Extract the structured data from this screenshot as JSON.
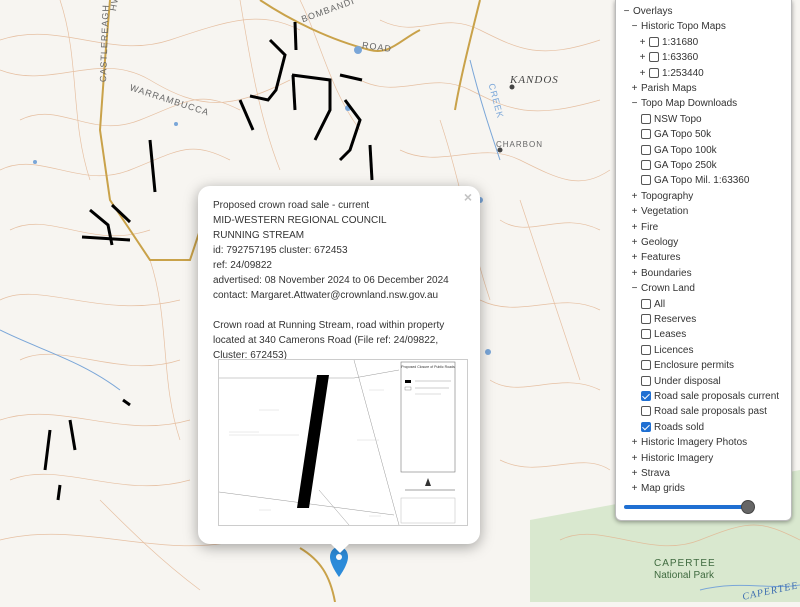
{
  "map": {
    "labels": {
      "castlereagh": "CASTLEREAGH",
      "hwy": "HWY",
      "bombandi": "BOMBANDI",
      "road": "ROAD",
      "warrumbucca": "WARRAMBUCCA",
      "kandos": "KANDOS",
      "charbon": "CHARBON",
      "capertee_np_1": "CAPERTEE",
      "capertee_np_2": "National Park",
      "capertee_bottom": "CAPERTEE",
      "creek": "CREEK"
    },
    "colors": {
      "background": "#f7f5f1",
      "contour": "#e2b38f",
      "road": "#c9a24a",
      "water": "#7aa6d8",
      "parcel": "#000000",
      "park": "#d9e8cf",
      "marker": "#2c8bd9"
    }
  },
  "popup": {
    "close_label": "×",
    "title": "Proposed crown road sale - current",
    "council": "MID-WESTERN REGIONAL COUNCIL",
    "locality": "RUNNING STREAM",
    "id_line": "id: 792757195 cluster: 672453",
    "ref_line": "ref: 24/09822",
    "advertised_line": "advertised: 08 November 2024 to 06 December 2024",
    "contact_line": "contact: Margaret.Attwater@crownland.nsw.gov.au",
    "description": "Crown road at Running Stream, road within property located at 340 Camerons Road (File ref: 24/09822, Cluster: 672453)",
    "thumbnail_legend_title": "Proposed Closure of Public Roads"
  },
  "layers": {
    "items": [
      {
        "label": "Overlays",
        "toggle": "−",
        "indent": 0
      },
      {
        "label": "Historic Topo Maps",
        "toggle": "−",
        "indent": 1
      },
      {
        "label": "1:31680",
        "toggle": "+",
        "checkbox": false,
        "indent": 2
      },
      {
        "label": "1:63360",
        "toggle": "+",
        "checkbox": false,
        "indent": 2
      },
      {
        "label": "1:253440",
        "toggle": "+",
        "checkbox": false,
        "indent": 2
      },
      {
        "label": "Parish Maps",
        "toggle": "+",
        "indent": 1
      },
      {
        "label": "Topo Map Downloads",
        "toggle": "−",
        "indent": 1
      },
      {
        "label": "NSW Topo",
        "checkbox": false,
        "indent": 2
      },
      {
        "label": "GA Topo 50k",
        "checkbox": false,
        "indent": 2
      },
      {
        "label": "GA Topo 100k",
        "checkbox": false,
        "indent": 2
      },
      {
        "label": "GA Topo 250k",
        "checkbox": false,
        "indent": 2
      },
      {
        "label": "GA Topo Mil. 1:63360",
        "checkbox": false,
        "indent": 2
      },
      {
        "label": "Topography",
        "toggle": "+",
        "indent": 1
      },
      {
        "label": "Vegetation",
        "toggle": "+",
        "indent": 1
      },
      {
        "label": "Fire",
        "toggle": "+",
        "indent": 1
      },
      {
        "label": "Geology",
        "toggle": "+",
        "indent": 1
      },
      {
        "label": "Features",
        "toggle": "+",
        "indent": 1
      },
      {
        "label": "Boundaries",
        "toggle": "+",
        "indent": 1
      },
      {
        "label": "Crown Land",
        "toggle": "−",
        "indent": 1
      },
      {
        "label": "All",
        "checkbox": false,
        "indent": 2
      },
      {
        "label": "Reserves",
        "checkbox": false,
        "indent": 2
      },
      {
        "label": "Leases",
        "checkbox": false,
        "indent": 2
      },
      {
        "label": "Licences",
        "checkbox": false,
        "indent": 2
      },
      {
        "label": "Enclosure permits",
        "checkbox": false,
        "indent": 2
      },
      {
        "label": "Under disposal",
        "checkbox": false,
        "indent": 2
      },
      {
        "label": "Road sale proposals current",
        "checkbox": true,
        "indent": 2
      },
      {
        "label": "Road sale proposals past",
        "checkbox": false,
        "indent": 2
      },
      {
        "label": "Roads sold",
        "checkbox": true,
        "indent": 2
      },
      {
        "label": "Historic Imagery Photos",
        "toggle": "+",
        "indent": 1
      },
      {
        "label": "Historic Imagery",
        "toggle": "+",
        "indent": 1
      },
      {
        "label": "Strava",
        "toggle": "+",
        "indent": 1
      },
      {
        "label": "Map grids",
        "toggle": "+",
        "indent": 1
      }
    ],
    "opacity": 0.9
  }
}
